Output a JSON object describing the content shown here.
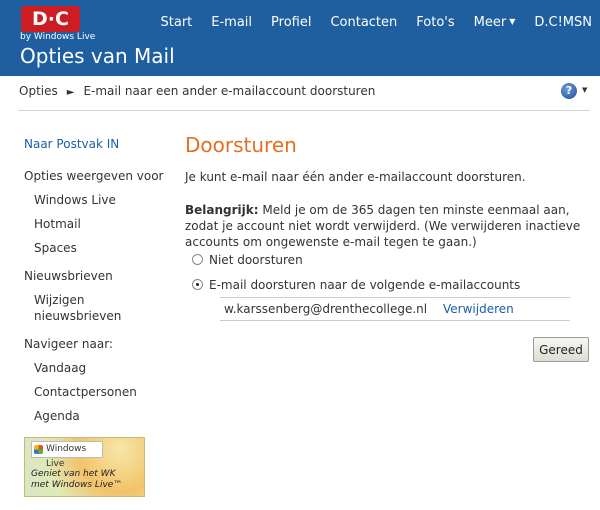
{
  "header": {
    "logo": "D·C",
    "byline": "by Windows Live",
    "title": "Opties van Mail",
    "nav": [
      "Start",
      "E-mail",
      "Profiel",
      "Contacten",
      "Foto's",
      "Meer",
      "D.C!MSN"
    ]
  },
  "breadcrumb": {
    "root": "Opties",
    "current": "E-mail naar een ander e-mailaccount doorsturen"
  },
  "help": {
    "icon": "help-icon",
    "symbol": "?"
  },
  "sidebar": {
    "primary": "Naar Postvak IN",
    "options_head": "Opties weergeven voor",
    "options": [
      "Windows Live",
      "Hotmail",
      "Spaces"
    ],
    "newsletters_head": "Nieuwsbrieven",
    "newsletters_sub_1": "Wijzigen",
    "newsletters_sub_2": "nieuwsbrieven",
    "navigate_head": "Navigeer naar:",
    "navigate": [
      "Vandaag",
      "Contactpersonen",
      "Agenda"
    ],
    "promo": {
      "logo": "Windows Live",
      "line1": "Geniet van het WK",
      "line2": "met Windows Live™"
    }
  },
  "main": {
    "title": "Doorsturen",
    "intro": "Je kunt e-mail naar één ander e-mailaccount doorsturen.",
    "important_label": "Belangrijk:",
    "important_text": " Meld je om de 365 dagen ten minste eenmaal aan, zodat je account niet wordt verwijderd. (We verwijderen inactieve accounts om ongewenste e-mail tegen te gaan.)",
    "option_off": "Niet doorsturen",
    "option_on": "E-mail doorsturen naar de volgende e-mailaccounts",
    "selected_option": "E-mail doorsturen naar de volgende e-mailaccounts",
    "forward_address": "w.karssenberg@drenthecollege.nl",
    "remove_label": "Verwijderen",
    "done_label": "Gereed"
  },
  "colors": {
    "header_bg": "#1f5fa0",
    "logo_red": "#cc1d24",
    "title_orange": "#e37022",
    "link_blue": "#1a5fa7"
  }
}
